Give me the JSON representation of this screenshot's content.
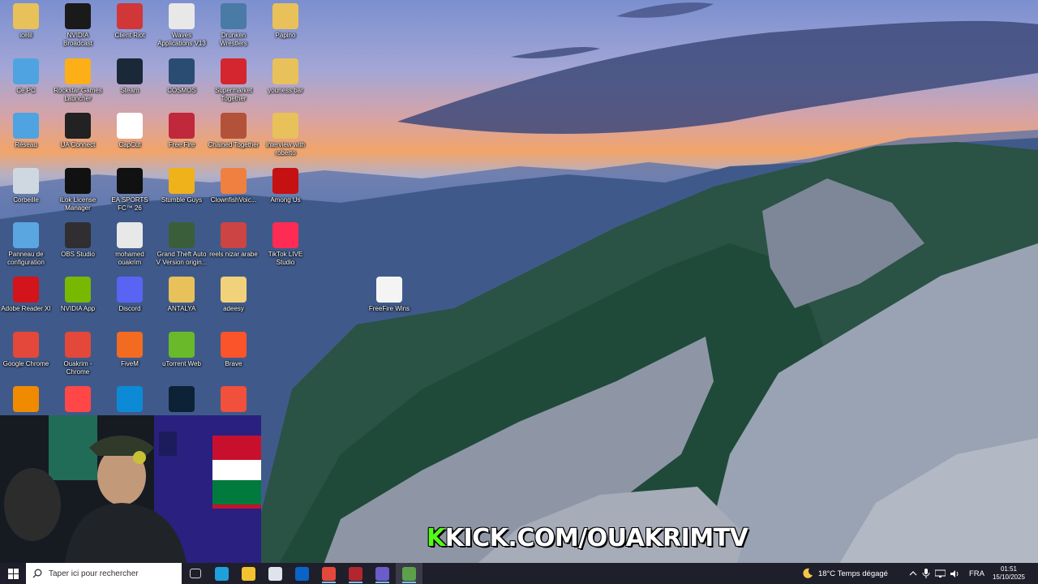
{
  "desktop": {
    "icons": [
      {
        "label": "icelil",
        "icon": "folder-user-icon",
        "color": "#e8c15a"
      },
      {
        "label": "Ce PC",
        "icon": "computer-icon",
        "color": "#4fa3e0"
      },
      {
        "label": "Réseau",
        "icon": "network-icon",
        "color": "#4fa3e0"
      },
      {
        "label": "Corbeille",
        "icon": "recycle-bin-icon",
        "color": "#cfd8e0"
      },
      {
        "label": "Panneau de configuration",
        "icon": "control-panel-icon",
        "color": "#5aa6e0"
      },
      {
        "label": "Adobe Reader XI",
        "icon": "adobe-reader-icon",
        "color": "#d3141a"
      },
      {
        "label": "Google Chrome",
        "icon": "chrome-icon",
        "color": "#e3483b"
      },
      {
        "label": "",
        "icon": "vlc-icon",
        "color": "#f08a00"
      },
      {
        "label": "NVIDIA Broadcast",
        "icon": "nvidia-broadcast-icon",
        "color": "#1a1a1a"
      },
      {
        "label": "Rockstar Games Launcher",
        "icon": "rockstar-icon",
        "color": "#fcaf17"
      },
      {
        "label": "UA Connect",
        "icon": "ua-connect-icon",
        "color": "#222"
      },
      {
        "label": "iLok License Manager",
        "icon": "ilok-icon",
        "color": "#111"
      },
      {
        "label": "OBS Studio",
        "icon": "obs-icon",
        "color": "#302e31"
      },
      {
        "label": "NVIDIA App",
        "icon": "nvidia-icon",
        "color": "#76b900"
      },
      {
        "label": "Ouakrim - Chrome",
        "icon": "chrome-profile-icon",
        "color": "#e3483b"
      },
      {
        "label": "",
        "icon": "ea-icon",
        "color": "#ff4747"
      },
      {
        "label": "Client Riot",
        "icon": "riot-icon",
        "color": "#d13639"
      },
      {
        "label": "Steam",
        "icon": "steam-icon",
        "color": "#1b2838"
      },
      {
        "label": "CapCut",
        "icon": "capcut-icon",
        "color": "#fff"
      },
      {
        "label": "EA SPORTS FC™ 26",
        "icon": "ea-fc-icon",
        "color": "#111"
      },
      {
        "label": "mohamed ouakrim",
        "icon": "file-icon",
        "color": "#e8e8e8"
      },
      {
        "label": "Discord",
        "icon": "discord-icon",
        "color": "#5865f2"
      },
      {
        "label": "FiveM",
        "icon": "fivem-icon",
        "color": "#f36b21"
      },
      {
        "label": "",
        "icon": "edge-icon",
        "color": "#0c8ad6"
      },
      {
        "label": "Waves Applications V13",
        "icon": "waves-icon",
        "color": "#e8e8e8"
      },
      {
        "label": "COSMOS",
        "icon": "cosmos-icon",
        "color": "#2a4c73"
      },
      {
        "label": "Free Fire",
        "icon": "free-fire-icon",
        "color": "#c0283c"
      },
      {
        "label": "Stumble Guys",
        "icon": "stumble-guys-icon",
        "color": "#f0b21b"
      },
      {
        "label": "Grand Theft Auto V Version origin...",
        "icon": "gta-v-icon",
        "color": "#3a5e3a"
      },
      {
        "label": "ANTALYA",
        "icon": "folder-icon",
        "color": "#e8c15a"
      },
      {
        "label": "uTorrent Web",
        "icon": "utorrent-icon",
        "color": "#6ab92b"
      },
      {
        "label": "",
        "icon": "app-circle-icon",
        "color": "#0d2236"
      },
      {
        "label": "Drunken Wrestlers",
        "icon": "drunken-wrestlers-icon",
        "color": "#4a7aa6"
      },
      {
        "label": "Supermarket Together",
        "icon": "supermarket-icon",
        "color": "#d3262e"
      },
      {
        "label": "Chained Together",
        "icon": "chained-together-icon",
        "color": "#b3523a"
      },
      {
        "label": "ClownfishVoic...",
        "icon": "clownfish-icon",
        "color": "#f08040"
      },
      {
        "label": "reels nizar arabe",
        "icon": "folder-icon",
        "color": "#c44"
      },
      {
        "label": "adeesy",
        "icon": "folder-icon",
        "color": "#f1d27a"
      },
      {
        "label": "Brave",
        "icon": "brave-icon",
        "color": "#fb542b"
      },
      {
        "label": "",
        "icon": "brave-alt-icon",
        "color": "#f0503c"
      },
      {
        "label": "Papino",
        "icon": "folder-icon",
        "color": "#e8c15a"
      },
      {
        "label": "youness bar",
        "icon": "folder-icon",
        "color": "#e8c15a"
      },
      {
        "label": "interview with roberto",
        "icon": "folder-icon",
        "color": "#e8c15a"
      },
      {
        "label": "Among Us",
        "icon": "among-us-icon",
        "color": "#c51111"
      },
      {
        "label": "TikTok LIVE Studio",
        "icon": "tiktok-icon",
        "color": "#fe2c55"
      },
      {
        "label": "FreeFire Wins",
        "icon": "text-file-icon",
        "color": "#f4f4f4"
      }
    ]
  },
  "overlay": {
    "kick_k": "K",
    "kick_text": "KICK.COM/OUAKRIMTV"
  },
  "taskbar": {
    "search_placeholder": "Taper ici pour rechercher",
    "pinned": [
      {
        "icon": "task-view-icon",
        "color": "#cfcfcf"
      },
      {
        "icon": "edge-icon",
        "color": "#1ea0db"
      },
      {
        "icon": "file-explorer-icon",
        "color": "#f2c230"
      },
      {
        "icon": "store-icon",
        "color": "#dfe4ea"
      },
      {
        "icon": "outlook-icon",
        "color": "#0a64c8"
      },
      {
        "icon": "chrome-icon",
        "color": "#e3483b"
      },
      {
        "icon": "chrome-profile-icon",
        "color": "#b3262e"
      },
      {
        "icon": "obs-icon",
        "color": "#6a5cc9"
      },
      {
        "icon": "streaming-app-icon",
        "color": "#5ca14a"
      }
    ],
    "weather": "18°C  Temps dégagé",
    "language": "FRA",
    "time": "01:51",
    "date": "15/10/2025"
  }
}
